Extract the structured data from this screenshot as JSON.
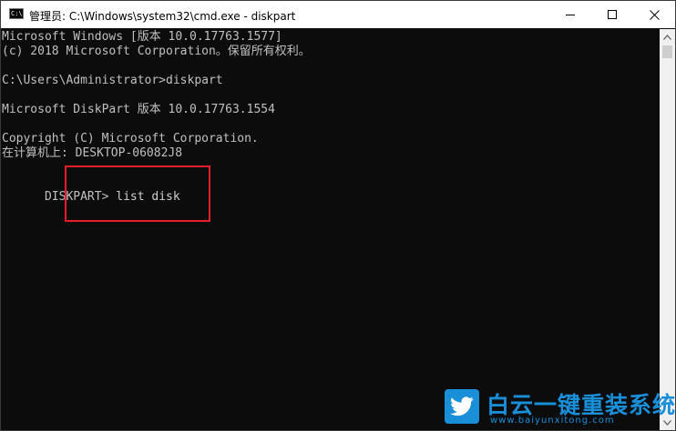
{
  "window": {
    "title": "管理员: C:\\Windows\\system32\\cmd.exe - diskpart",
    "icon_label": "C:\\"
  },
  "terminal": {
    "lines": [
      "Microsoft Windows [版本 10.0.17763.1577]",
      "(c) 2018 Microsoft Corporation。保留所有权利。",
      "",
      "C:\\Users\\Administrator>diskpart",
      "",
      "Microsoft DiskPart 版本 10.0.17763.1554",
      "",
      "Copyright (C) Microsoft Corporation.",
      "在计算机上: DESKTOP-06082J8",
      ""
    ],
    "prompt": "DISKPART> ",
    "command": "list disk"
  },
  "watermark": {
    "title": "白云一键重装系统",
    "url": "www.baiyunxitong.com"
  },
  "colors": {
    "console_bg": "#0c0c0c",
    "console_fg": "#c0c0c0",
    "highlight": "#e81e2a",
    "brand": "#1a8fd9"
  },
  "icons": {
    "app": "cmd-app-icon",
    "minimize": "minimize-icon",
    "maximize": "maximize-icon",
    "close": "close-icon",
    "logo": "twitter-bird-logo-icon"
  }
}
